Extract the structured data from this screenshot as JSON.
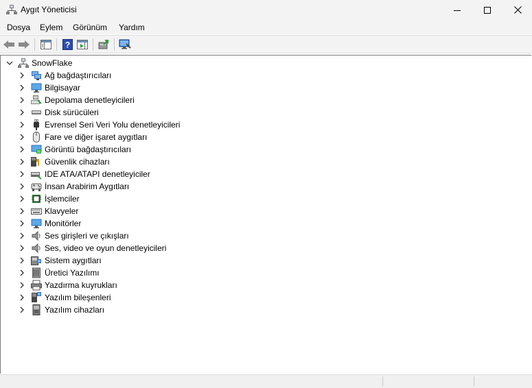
{
  "window": {
    "title": "Aygıt Yöneticisi",
    "icon": "device-manager-icon"
  },
  "menu": [
    "Dosya",
    "Eylem",
    "Görünüm",
    "Yardım"
  ],
  "toolbar": {
    "buttons": [
      "back-arrow-icon",
      "forward-arrow-icon",
      "show-hide-console-tree-icon",
      "help-icon",
      "action-pane-icon",
      "update-driver-icon",
      "scan-hardware-icon"
    ]
  },
  "tree": {
    "root": "SnowFlake",
    "categories": [
      {
        "label": "Ağ bağdaştırıcıları",
        "icon": "network-adapter-icon"
      },
      {
        "label": "Bilgisayar",
        "icon": "computer-icon"
      },
      {
        "label": "Depolama denetleyicileri",
        "icon": "storage-controller-icon"
      },
      {
        "label": "Disk sürücüleri",
        "icon": "disk-drive-icon"
      },
      {
        "label": "Evrensel Seri Veri Yolu denetleyicileri",
        "icon": "usb-icon"
      },
      {
        "label": "Fare ve diğer işaret aygıtları",
        "icon": "mouse-icon"
      },
      {
        "label": "Görüntü bağdaştırıcıları",
        "icon": "display-adapter-icon"
      },
      {
        "label": "Güvenlik cihazları",
        "icon": "security-device-icon"
      },
      {
        "label": "IDE ATA/ATAPI denetleyiciler",
        "icon": "ide-controller-icon"
      },
      {
        "label": "İnsan Arabirim Aygıtları",
        "icon": "hid-icon"
      },
      {
        "label": "İşlemciler",
        "icon": "processor-icon"
      },
      {
        "label": "Klavyeler",
        "icon": "keyboard-icon"
      },
      {
        "label": "Monitörler",
        "icon": "monitor-icon"
      },
      {
        "label": "Ses girişleri ve çıkışları",
        "icon": "audio-io-icon"
      },
      {
        "label": "Ses, video ve oyun denetleyicileri",
        "icon": "sound-video-icon"
      },
      {
        "label": "Sistem aygıtları",
        "icon": "system-device-icon"
      },
      {
        "label": "Üretici Yazılımı",
        "icon": "firmware-icon"
      },
      {
        "label": "Yazdırma kuyrukları",
        "icon": "print-queue-icon"
      },
      {
        "label": "Yazılım bileşenleri",
        "icon": "software-component-icon"
      },
      {
        "label": "Yazılım cihazları",
        "icon": "software-device-icon"
      }
    ]
  },
  "colors": {
    "chrome": "#f3f3f3",
    "accent_blue": "#1a73c7",
    "icon_gray": "#6b6b6b"
  }
}
